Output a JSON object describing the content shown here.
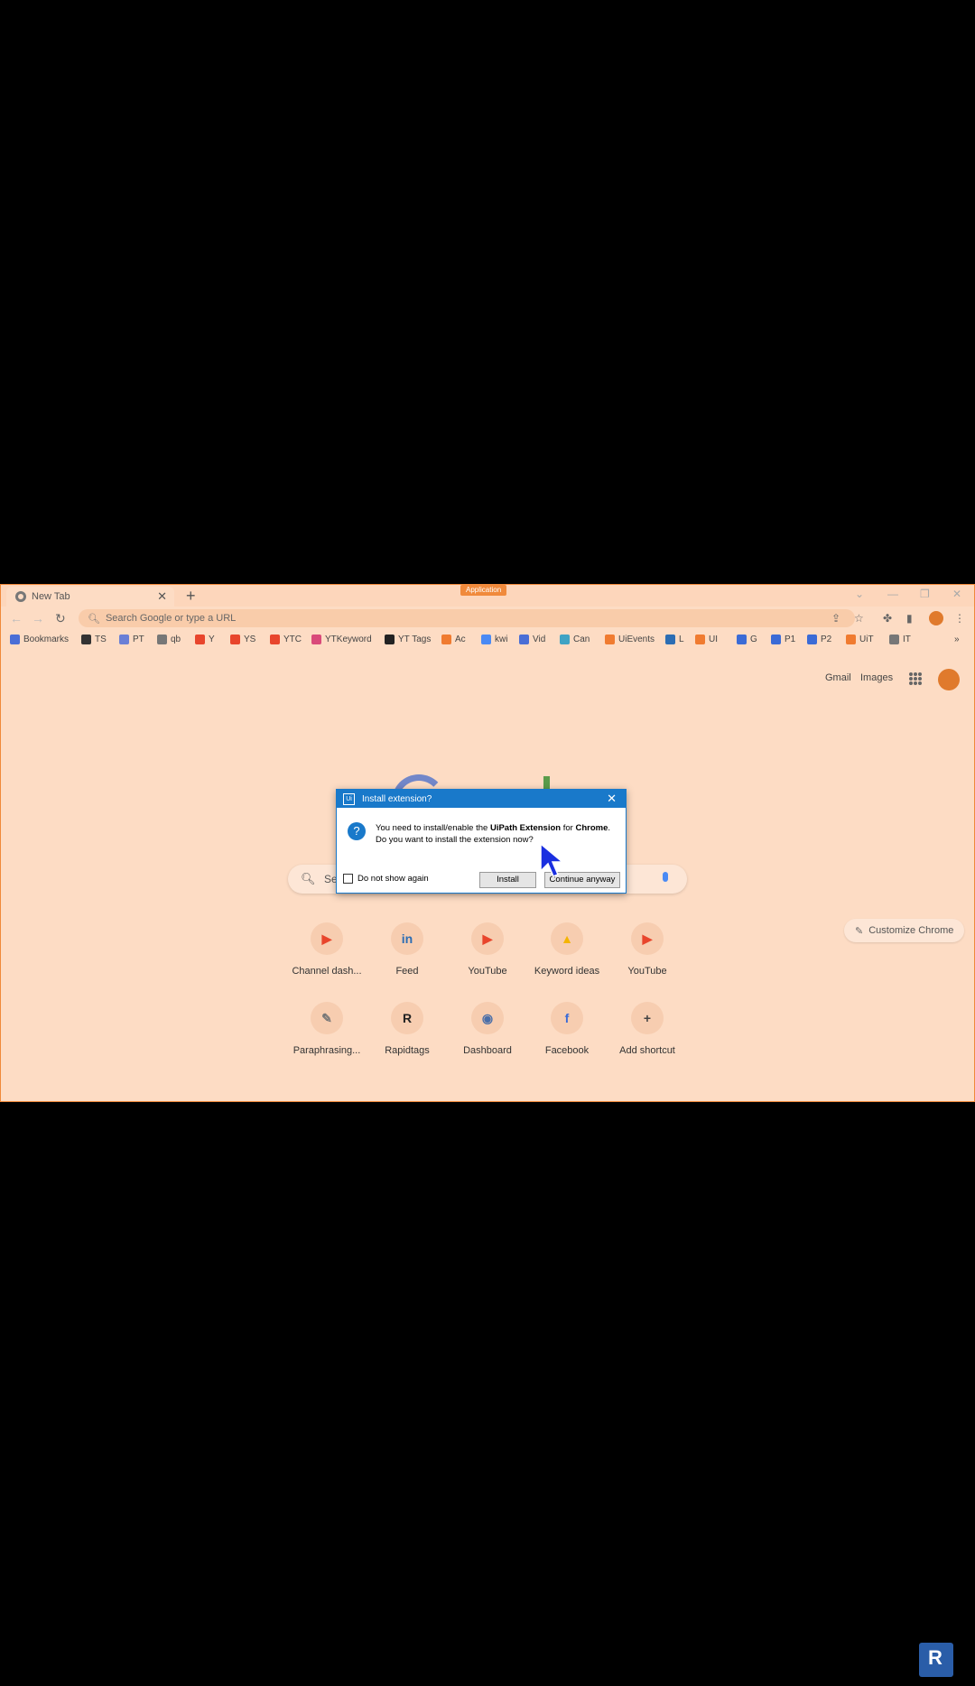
{
  "tab": {
    "title": "New Tab"
  },
  "app_badge": "Application",
  "omnibox": {
    "placeholder": "Search Google or type a URL"
  },
  "bookmarks": [
    {
      "label": "Bookmarks",
      "icon": "star-icon",
      "color": "#4a6ed6"
    },
    {
      "label": "TS",
      "icon": "ts-icon",
      "color": "#333333"
    },
    {
      "label": "PT",
      "icon": "doc-icon",
      "color": "#6a7fd6"
    },
    {
      "label": "qb",
      "icon": "quill-icon",
      "color": "#777777"
    },
    {
      "label": "Y",
      "icon": "youtube-icon",
      "color": "#e8452c"
    },
    {
      "label": "YS",
      "icon": "youtube-icon",
      "color": "#e8452c"
    },
    {
      "label": "YTC",
      "icon": "youtube-icon",
      "color": "#e8452c"
    },
    {
      "label": "YTKeyword",
      "icon": "keyword-icon",
      "color": "#d94a7a"
    },
    {
      "label": "YT Tags",
      "icon": "r-icon",
      "color": "#222222"
    },
    {
      "label": "Ac",
      "icon": "uipath-icon",
      "color": "#f07b30"
    },
    {
      "label": "kwi",
      "icon": "ads-icon",
      "color": "#4a8af4"
    },
    {
      "label": "Vid",
      "icon": "vid-icon",
      "color": "#4a6ed6"
    },
    {
      "label": "Can",
      "icon": "canva-icon",
      "color": "#3fa3c4"
    },
    {
      "label": "UiEvents",
      "icon": "uipath-icon",
      "color": "#f07b30"
    },
    {
      "label": "L",
      "icon": "linkedin-icon",
      "color": "#2c6db3"
    },
    {
      "label": "UI",
      "icon": "uipath-icon",
      "color": "#f07b30"
    },
    {
      "label": "G",
      "icon": "facebook-icon",
      "color": "#3b6bd6"
    },
    {
      "label": "P1",
      "icon": "facebook-icon",
      "color": "#3b6bd6"
    },
    {
      "label": "P2",
      "icon": "facebook-icon",
      "color": "#3b6bd6"
    },
    {
      "label": "UiT",
      "icon": "uipath-icon",
      "color": "#f07b30"
    },
    {
      "label": "IT",
      "icon": "people-icon",
      "color": "#777777"
    }
  ],
  "gbar": {
    "gmail": "Gmail",
    "images": "Images"
  },
  "search": {
    "text": "Se"
  },
  "shortcuts": [
    {
      "label": "Channel dash...",
      "icon": "youtube-icon",
      "glyph": "▶",
      "color": "#e8452c"
    },
    {
      "label": "Feed",
      "icon": "linkedin-icon",
      "glyph": "in",
      "color": "#2c6db3"
    },
    {
      "label": "YouTube",
      "icon": "youtube-icon",
      "glyph": "▶",
      "color": "#e8452c"
    },
    {
      "label": "Keyword ideas",
      "icon": "ads-icon",
      "glyph": "▲",
      "color": "#f4b400"
    },
    {
      "label": "YouTube",
      "icon": "youtube-icon",
      "glyph": "▶",
      "color": "#e8452c"
    },
    {
      "label": "Paraphrasing...",
      "icon": "quill-icon",
      "glyph": "✎",
      "color": "#777777"
    },
    {
      "label": "Rapidtags",
      "icon": "r-icon",
      "glyph": "R",
      "color": "#222222"
    },
    {
      "label": "Dashboard",
      "icon": "dashboard-icon",
      "glyph": "◉",
      "color": "#4a6ea8"
    },
    {
      "label": "Facebook",
      "icon": "facebook-icon",
      "glyph": "f",
      "color": "#3b6bd6"
    },
    {
      "label": "Add shortcut",
      "icon": "plus-icon",
      "glyph": "+",
      "color": "#444444"
    }
  ],
  "customize": "Customize Chrome",
  "dialog": {
    "title": "Install extension?",
    "msg_pre": "You need to install/enable the ",
    "msg_bold1": "UiPath Extension",
    "msg_mid": " for ",
    "msg_bold2": "Chrome",
    "msg_end": ".",
    "msg_line2": "Do you want to install the extension now?",
    "checkbox": "Do not show again",
    "install": "Install",
    "continue": "Continue anyway"
  }
}
